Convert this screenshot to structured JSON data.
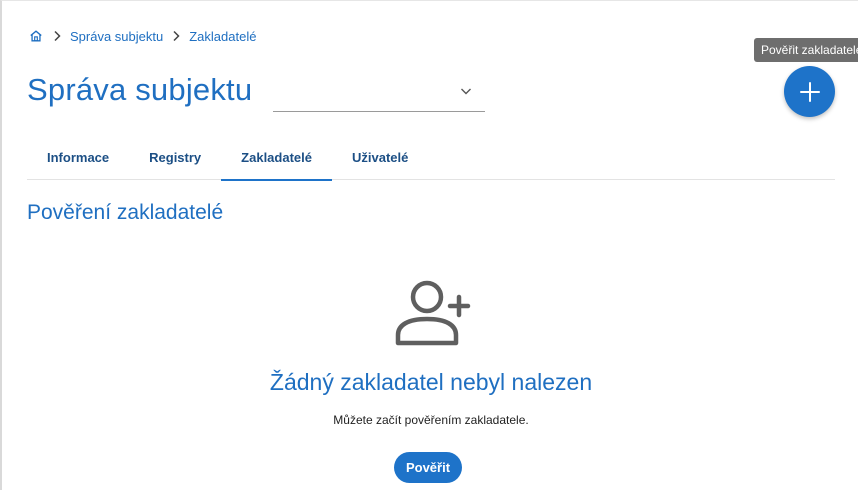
{
  "breadcrumb": {
    "home_icon": "home-icon",
    "separator_icon": "chevron-right-icon",
    "items": [
      {
        "label": "Správa subjektu"
      },
      {
        "label": "Zakladatelé"
      }
    ]
  },
  "header": {
    "title": "Správa subjektu",
    "subject_select": {
      "value": "",
      "icon": "chevron-down-icon"
    },
    "add_button": {
      "icon": "plus-icon",
      "tooltip": "Pověřit zakladatele"
    }
  },
  "tabs": [
    {
      "label": "Informace",
      "active": false
    },
    {
      "label": "Registry",
      "active": false
    },
    {
      "label": "Zakladatelé",
      "active": true
    },
    {
      "label": "Uživatelé",
      "active": false
    }
  ],
  "section": {
    "title": "Pověření zakladatelé"
  },
  "empty_state": {
    "icon": "person-add-icon",
    "title": "Žádný zakladatel nebyl nalezen",
    "text": "Můžete začít pověřením zakladatele.",
    "button_label": "Pověřit"
  },
  "colors": {
    "accent": "#1e73c9",
    "heading": "#1f6fc1",
    "tab_text": "#1c4f85",
    "tooltip_bg": "#6e6e6e"
  }
}
